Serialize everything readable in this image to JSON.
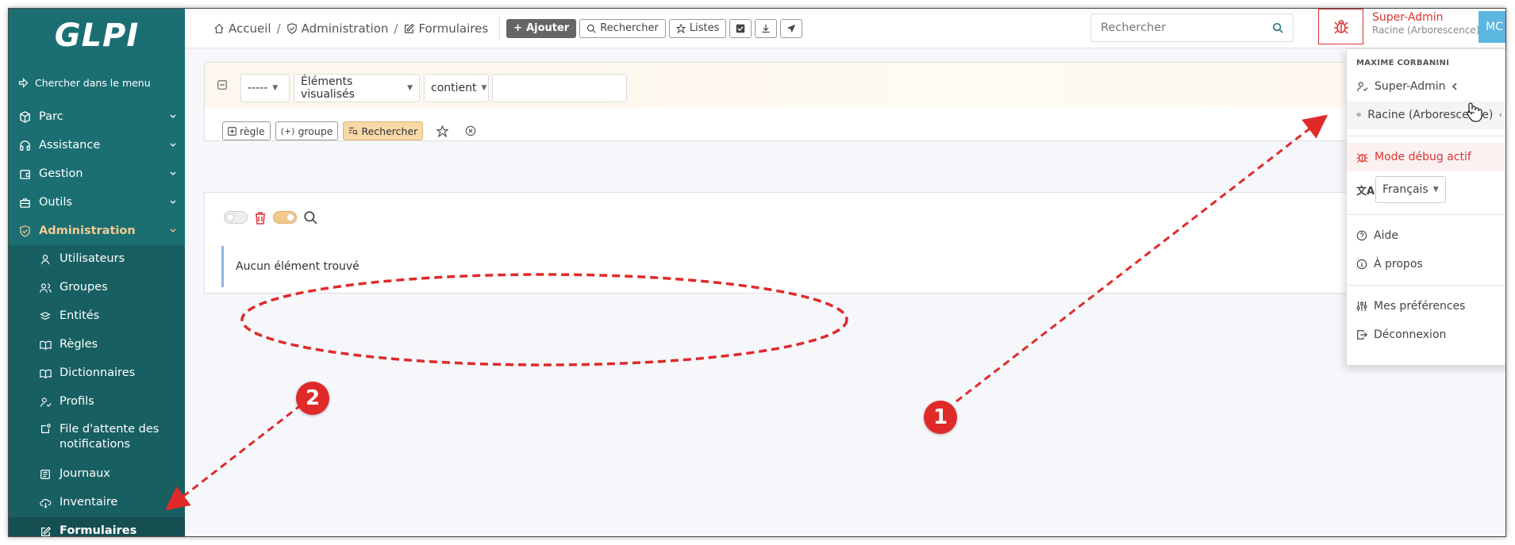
{
  "app": {
    "logo_text": "GLPI"
  },
  "sidebar": {
    "menu_search": "Chercher dans le menu",
    "items": [
      {
        "label": "Parc",
        "icon": "box-icon"
      },
      {
        "label": "Assistance",
        "icon": "headset-icon"
      },
      {
        "label": "Gestion",
        "icon": "wallet-icon"
      },
      {
        "label": "Outils",
        "icon": "briefcase-icon"
      },
      {
        "label": "Administration",
        "icon": "shield-check-icon",
        "active": true
      }
    ],
    "submenu": [
      {
        "label": "Utilisateurs",
        "icon": "user-icon"
      },
      {
        "label": "Groupes",
        "icon": "users-icon"
      },
      {
        "label": "Entités",
        "icon": "layers-icon"
      },
      {
        "label": "Règles",
        "icon": "book-icon"
      },
      {
        "label": "Dictionnaires",
        "icon": "book-icon"
      },
      {
        "label": "Profils",
        "icon": "user-check-icon"
      },
      {
        "label": "File d'attente des notifications",
        "icon": "notification-icon"
      },
      {
        "label": "Journaux",
        "icon": "news-icon"
      },
      {
        "label": "Inventaire",
        "icon": "cloud-download-icon"
      },
      {
        "label": "Formulaires",
        "icon": "edit-icon",
        "active": true
      }
    ]
  },
  "breadcrumb": {
    "home": "Accueil",
    "admin": "Administration",
    "current": "Formulaires",
    "separator": "/"
  },
  "toolbar": {
    "add": "Ajouter",
    "search": "Rechercher",
    "lists": "Listes"
  },
  "top_search": {
    "placeholder": "Rechercher"
  },
  "user": {
    "profile": "Super-Admin",
    "entity": "Racine (Arborescence)",
    "initials": "MC"
  },
  "criteria": {
    "field1": "-----",
    "field2": "Éléments visualisés",
    "operator": "contient",
    "value": "",
    "rule_btn": "règle",
    "group_btn": "groupe",
    "search_btn": "Rechercher"
  },
  "results": {
    "empty": "Aucun élément trouvé"
  },
  "dropdown": {
    "header": "MAXIME CORBANINI",
    "profile": "Super-Admin",
    "entity": "Racine (Arborescence)",
    "debug": "Mode débug actif",
    "language": "Français",
    "help": "Aide",
    "about": "À propos",
    "prefs": "Mes préférences",
    "logout": "Déconnexion"
  },
  "annotations": {
    "badge1": "1",
    "badge2": "2"
  },
  "colors": {
    "sidebar": "#1b6f72",
    "accent": "#f7c98f",
    "debug_red": "#d33333",
    "annotation_red": "#e02a2a"
  }
}
